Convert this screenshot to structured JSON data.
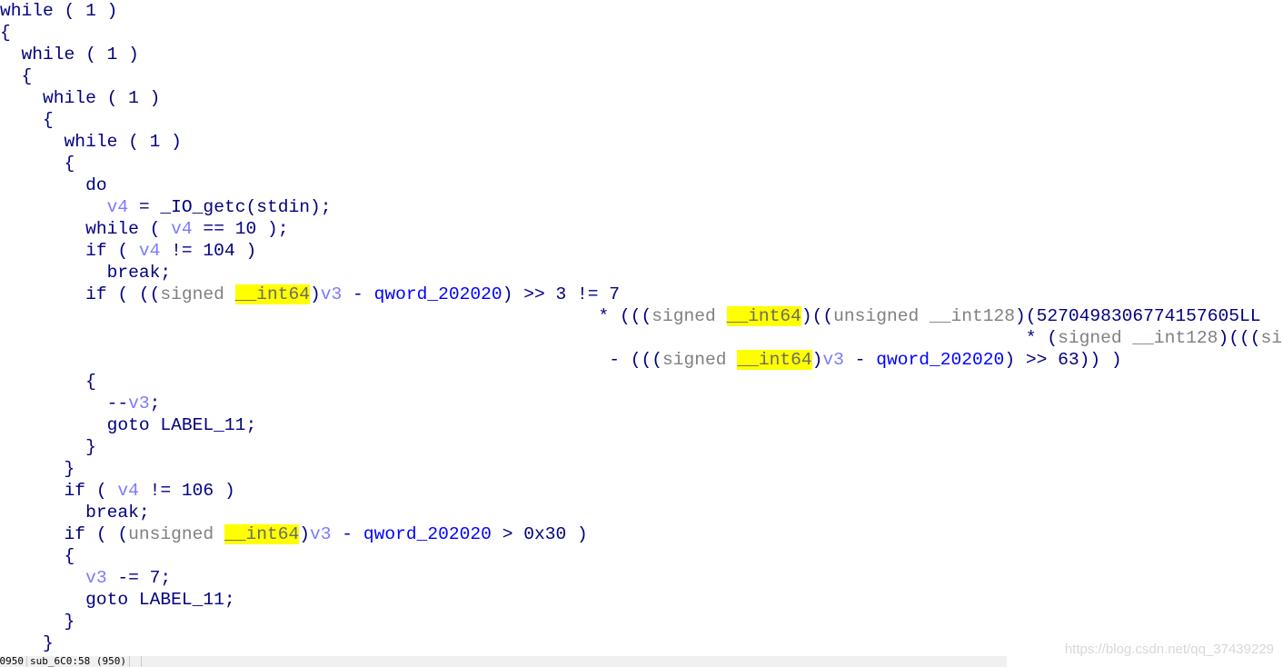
{
  "colors": {
    "keyword": "#000080",
    "type": "#808080",
    "variable": "#7b7bff",
    "global": "#0000ff",
    "highlight": "#ffff00"
  },
  "code_lines": [
    [
      [
        "while ( 1 )",
        "k"
      ]
    ],
    [
      [
        "{",
        "k"
      ]
    ],
    [
      [
        "  while ( 1 )",
        "k"
      ]
    ],
    [
      [
        "  {",
        "k"
      ]
    ],
    [
      [
        "    while ( 1 )",
        "k"
      ]
    ],
    [
      [
        "    {",
        "k"
      ]
    ],
    [
      [
        "      while ( 1 )",
        "k"
      ]
    ],
    [
      [
        "      {",
        "k"
      ]
    ],
    [
      [
        "        do",
        "k"
      ]
    ],
    [
      [
        "          ",
        "k"
      ],
      [
        "v4",
        "v"
      ],
      [
        " = _IO_getc(stdin);",
        "k"
      ]
    ],
    [
      [
        "        while ( ",
        "k"
      ],
      [
        "v4",
        "v"
      ],
      [
        " == 10 );",
        "k"
      ]
    ],
    [
      [
        "        if ( ",
        "k"
      ],
      [
        "v4",
        "v"
      ],
      [
        " != 104 )",
        "k"
      ]
    ],
    [
      [
        "          break;",
        "k"
      ]
    ],
    [
      [
        "        if ( ((",
        "k"
      ],
      [
        "signed ",
        "t"
      ],
      [
        "__int64",
        "h"
      ],
      [
        ")",
        "k"
      ],
      [
        "v3",
        "v"
      ],
      [
        " - ",
        "k"
      ],
      [
        "qword_202020",
        "g"
      ],
      [
        ") >> 3 != 7",
        "k"
      ]
    ],
    [
      [
        "                                                        * (((",
        "k"
      ],
      [
        "signed ",
        "t"
      ],
      [
        "__int64",
        "h"
      ],
      [
        ")((",
        "k"
      ],
      [
        "unsigned __int128",
        "t"
      ],
      [
        ")(5270498306774157605LL",
        "k"
      ]
    ],
    [
      [
        "                                                                                                * (",
        "k"
      ],
      [
        "signed __int128",
        "t"
      ],
      [
        ")(((",
        "k"
      ],
      [
        "si",
        "t"
      ]
    ],
    [
      [
        "                                                         - (((",
        "k"
      ],
      [
        "signed ",
        "t"
      ],
      [
        "__int64",
        "h"
      ],
      [
        ")",
        "k"
      ],
      [
        "v3",
        "v"
      ],
      [
        " - ",
        "k"
      ],
      [
        "qword_202020",
        "g"
      ],
      [
        ") >> 63)) )",
        "k"
      ]
    ],
    [
      [
        "        {",
        "k"
      ]
    ],
    [
      [
        "          --",
        "k"
      ],
      [
        "v3",
        "v"
      ],
      [
        ";",
        "k"
      ]
    ],
    [
      [
        "          goto LABEL_11;",
        "k"
      ]
    ],
    [
      [
        "        }",
        "k"
      ]
    ],
    [
      [
        "      }",
        "k"
      ]
    ],
    [
      [
        "      if ( ",
        "k"
      ],
      [
        "v4",
        "v"
      ],
      [
        " != 106 )",
        "k"
      ]
    ],
    [
      [
        "        break;",
        "k"
      ]
    ],
    [
      [
        "      if ( (",
        "k"
      ],
      [
        "unsigned ",
        "t"
      ],
      [
        "__int64",
        "h"
      ],
      [
        ")",
        "k"
      ],
      [
        "v3",
        "v"
      ],
      [
        " - ",
        "k"
      ],
      [
        "qword_202020",
        "g"
      ],
      [
        " > 0x30 )",
        "k"
      ]
    ],
    [
      [
        "      {",
        "k"
      ]
    ],
    [
      [
        "        ",
        "k"
      ],
      [
        "v3",
        "v"
      ],
      [
        " -= 7;",
        "k"
      ]
    ],
    [
      [
        "        goto LABEL_11;",
        "k"
      ]
    ],
    [
      [
        "      }",
        "k"
      ]
    ],
    [
      [
        "    }",
        "k"
      ]
    ]
  ],
  "status_bar": {
    "address": "00000950",
    "location": "sub_6C0:58 (950)",
    "extra": ""
  },
  "watermark": "https://blog.csdn.net/qq_37439229"
}
